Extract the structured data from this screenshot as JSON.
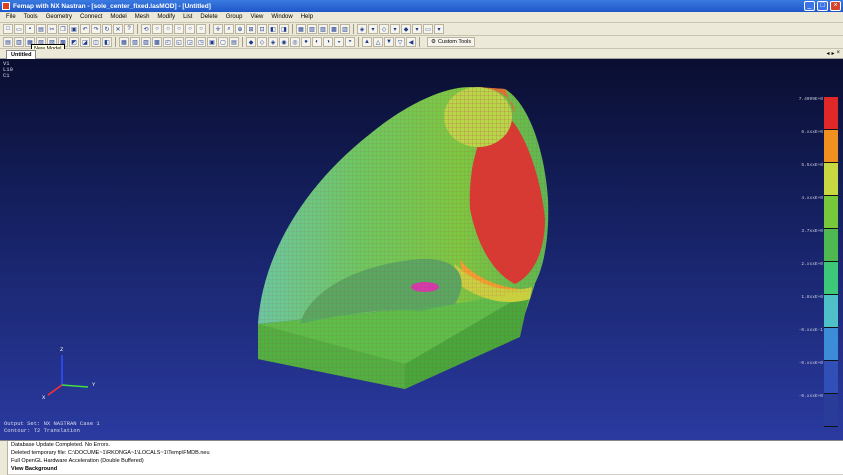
{
  "window": {
    "title": "Femap with NX Nastran - [sole_center_fixed.lasMOD] - [Untitled]"
  },
  "menu": [
    "File",
    "Tools",
    "Geometry",
    "Connect",
    "Model",
    "Mesh",
    "Modify",
    "List",
    "Delete",
    "Group",
    "View",
    "Window",
    "Help"
  ],
  "toolbar": {
    "custom_tools_label": "Custom Tools",
    "tooltip": "New Model"
  },
  "tabs": {
    "active": "Untitled"
  },
  "viewport": {
    "view_labels": [
      "V1",
      "L10",
      "C1"
    ],
    "output_set": "Output Set: NX NASTRAN Case 1",
    "contour": "Contour: T2 Translation",
    "axis_labels": {
      "z": "Z",
      "x": "X",
      "y": "Y"
    }
  },
  "legend": {
    "colors": [
      "#e02828",
      "#f0901e",
      "#c8d840",
      "#78c83c",
      "#50b850",
      "#3cc878",
      "#50c0c8",
      "#3c8cd8",
      "#3050b8",
      "#283c98",
      "#1a2880"
    ],
    "labels": [
      "7.4099E+0",
      "6.xxxE+0",
      "5.5xxE+0",
      "4.xxxE+0",
      "3.7xxE+0",
      "2.xxxE+0",
      "1.8xxE+0",
      "-0.xxxE-1",
      "-0.xxxE+0",
      "-0.xxxE+0",
      "-4.xxxE+0"
    ]
  },
  "messages": [
    "Database Update Completed. No Errors.",
    "Deleted temporary file: C:\\DOCUME~1\\RKONGA~1\\LOCALS~1\\Temp\\FMDB.neu",
    "Full OpenGL Hardware Acceleration (Double Buffered)",
    "View Background"
  ]
}
